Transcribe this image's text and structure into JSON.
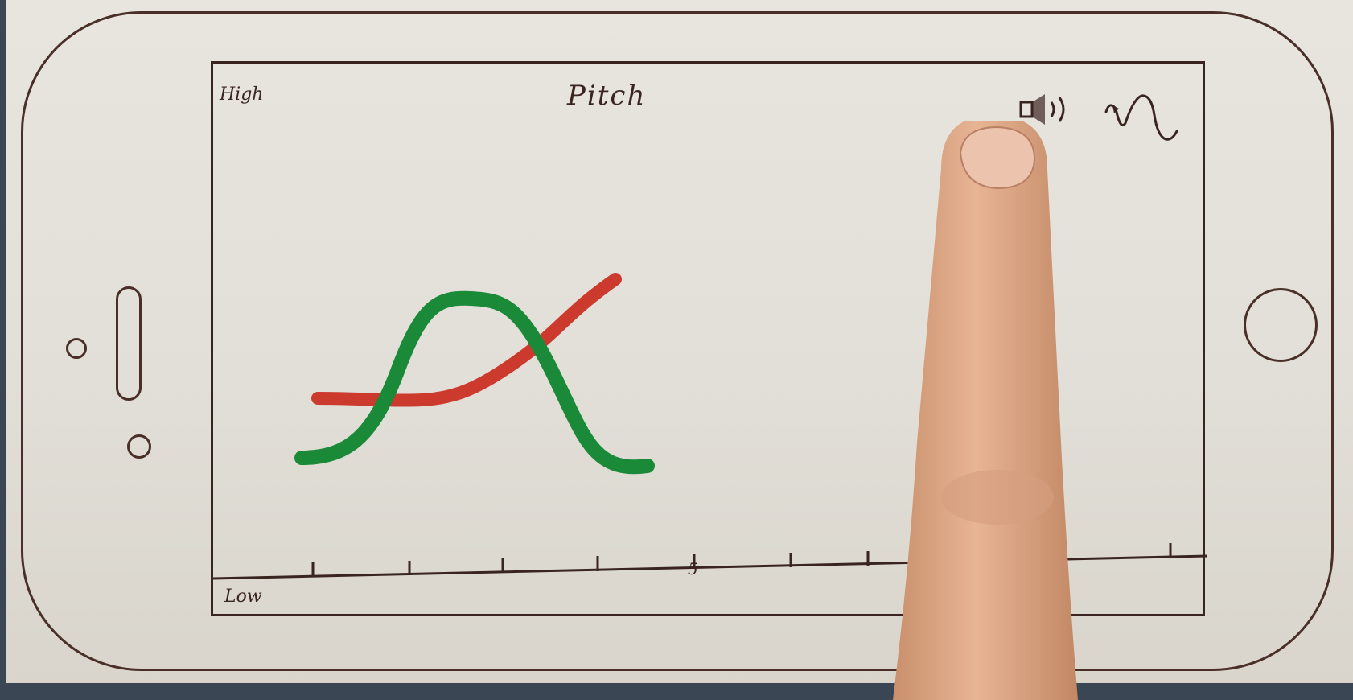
{
  "screen": {
    "title": "Pitch",
    "y_high_label": "High",
    "y_low_label": "Low",
    "x_tick_label": "5"
  },
  "icons": {
    "speaker": "speaker-icon",
    "waveform": "sine-wave-icon",
    "home": "home-button-icon"
  },
  "colors": {
    "reference_line": "#cc3a2e",
    "user_line": "#1a8a38",
    "ink": "#3a2420"
  }
}
